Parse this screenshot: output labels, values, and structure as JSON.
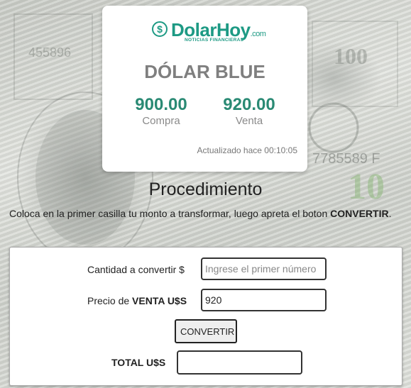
{
  "logo": {
    "icon": "dollar-coin-icon",
    "name": "DolarHoy",
    "tld": ".com",
    "tagline": "NOTICIAS FINANCIERAS"
  },
  "rate_card": {
    "title": "DÓLAR BLUE",
    "buy_value": "900.00",
    "buy_label": "Compra",
    "sell_value": "920.00",
    "sell_label": "Venta",
    "updated": "Actualizado hace 00:10:05"
  },
  "procedure": {
    "title": "Procedimiento",
    "text": "Coloca en la primer casilla tu monto a transformar, luego apreta el boton ",
    "text_bold": "CONVERTIR",
    "text_end": "."
  },
  "form": {
    "amount_label": "Cantidad a convertir $",
    "amount_placeholder": "Ingrese el primer número",
    "amount_value": "",
    "price_label_prefix": "Precio de ",
    "price_label_bold": "VENTA U$S",
    "price_value": "920",
    "convert_button": "CONVERTIR",
    "total_label": "TOTAL U$S",
    "total_value": ""
  },
  "colors": {
    "brand": "#1d9a84",
    "price": "#2a8a74",
    "title_gray": "#7f7f7f"
  }
}
